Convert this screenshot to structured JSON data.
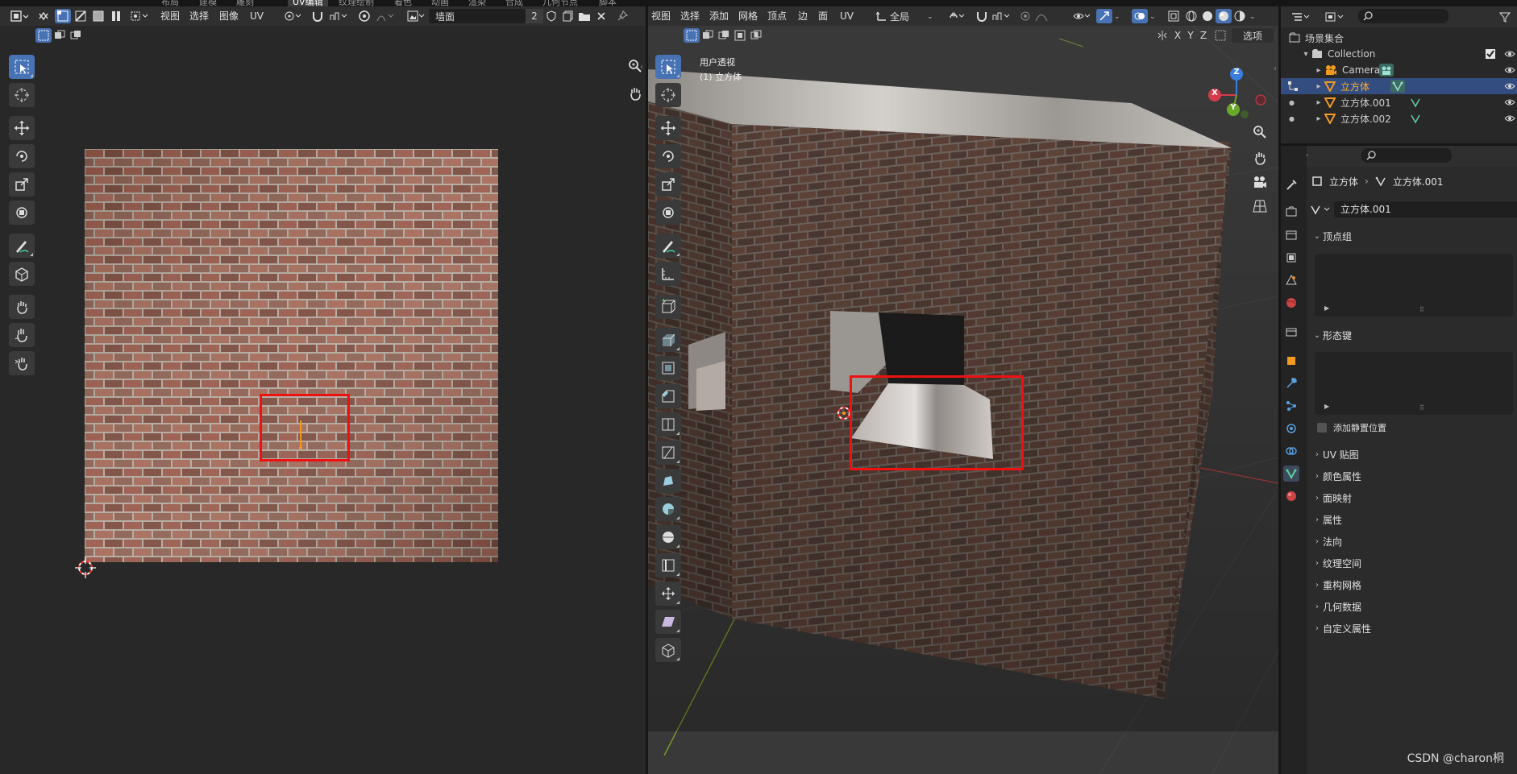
{
  "topbar": {
    "tabs": [
      "布局",
      "建模",
      "雕刻",
      "UV编辑",
      "纹理绘制",
      "着色",
      "动画",
      "渲染",
      "合成",
      "几何节点",
      "脚本"
    ],
    "active_tab": "UV编辑"
  },
  "uv_editor": {
    "menus": [
      "视图",
      "选择",
      "图像",
      "UV"
    ],
    "image_name": "墙面",
    "user_count": "2"
  },
  "viewport": {
    "menus": [
      "视图",
      "选择",
      "添加",
      "网格",
      "顶点",
      "边",
      "面",
      "UV"
    ],
    "transform_orientation": "全局",
    "axis_labels": [
      "X",
      "Y",
      "Z"
    ],
    "options_label": "选项",
    "view_name": "用户透视",
    "object_info": "(1) 立方体",
    "gizmo": {
      "x": "X",
      "y": "Y",
      "z": "Z",
      "x_color": "#d63b4b",
      "y_color": "#6aa82a",
      "z_color": "#3a7ee0"
    }
  },
  "outliner": {
    "scene_collection": "场景集合",
    "collection": "Collection",
    "items": [
      {
        "name": "Camera",
        "type": "camera",
        "selected": false
      },
      {
        "name": "立方体",
        "type": "mesh",
        "selected": true
      },
      {
        "name": "立方体.001",
        "type": "mesh",
        "selected": false
      },
      {
        "name": "立方体.002",
        "type": "mesh",
        "selected": false
      }
    ]
  },
  "properties": {
    "breadcrumb_object": "立方体",
    "breadcrumb_mesh": "立方体.001",
    "mesh_datablock": "立方体.001",
    "panels_open": [
      "顶点组",
      "形态键"
    ],
    "checkbox_label": "添加静置位置",
    "panels_closed": [
      "UV 贴图",
      "颜色属性",
      "面映射",
      "属性",
      "法向",
      "纹理空间",
      "重构网格",
      "几何数据",
      "自定义属性"
    ]
  },
  "watermark": "CSDN @charon桐",
  "colors": {
    "accent": "#4772b3",
    "selection": "#334d80",
    "highlight_box": "#e11111",
    "brick": "#8a5a4a"
  }
}
